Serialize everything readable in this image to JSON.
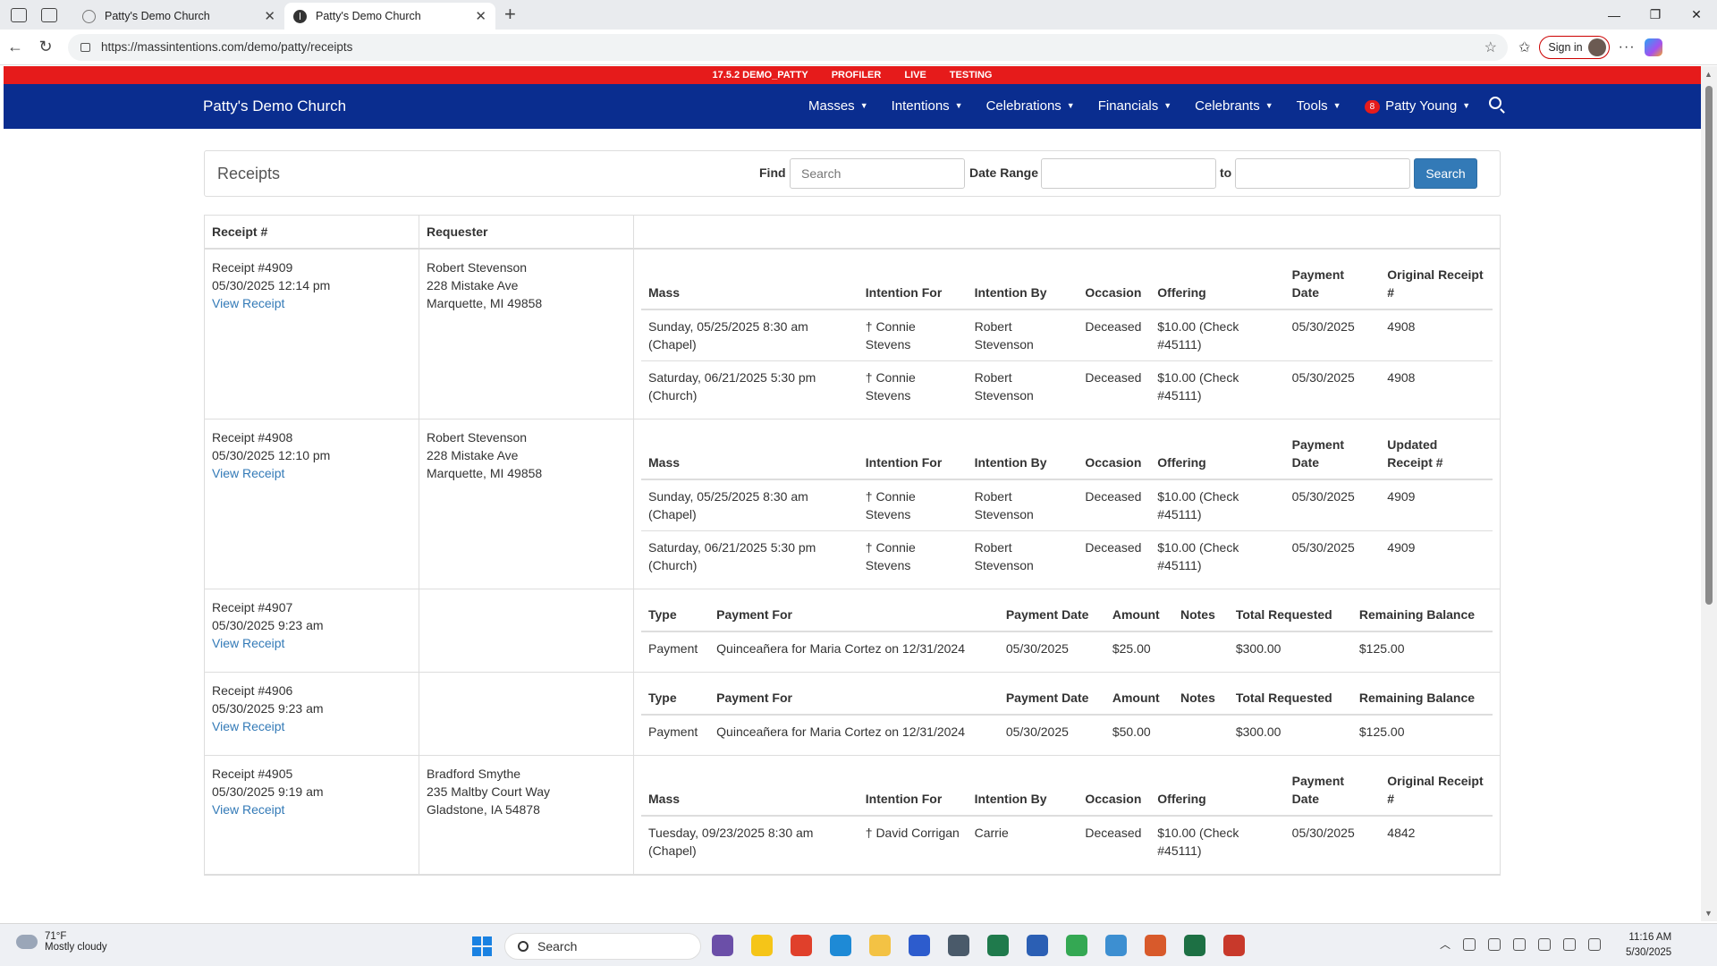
{
  "browser": {
    "tabs": [
      {
        "title": "Patty's Demo Church",
        "active": false
      },
      {
        "title": "Patty's Demo Church",
        "active": true
      }
    ],
    "url": "https://massintentions.com/demo/patty/receipts",
    "signin_label": "Sign in"
  },
  "env_bar": [
    "17.5.2 DEMO_PATTY",
    "PROFILER",
    "LIVE",
    "TESTING"
  ],
  "navbar": {
    "brand": "Patty's Demo Church",
    "menu": [
      "Masses",
      "Intentions",
      "Celebrations",
      "Financials",
      "Celebrants",
      "Tools"
    ],
    "user": {
      "badge": "8",
      "name": "Patty Young"
    }
  },
  "receipts_panel": {
    "title": "Receipts",
    "find_label": "Find",
    "find_placeholder": "Search",
    "date_range_label": "Date Range",
    "to_label": "to",
    "search_button": "Search"
  },
  "table": {
    "headers": [
      "Receipt #",
      "Requester"
    ],
    "receipts": [
      {
        "number": "Receipt #4909",
        "datetime": "05/30/2025 12:14 pm",
        "link": "View Receipt",
        "requester": [
          "Robert Stevenson",
          "228 Mistake Ave",
          "Marquette, MI 49858"
        ],
        "kind": "intentions",
        "columns": [
          "Mass",
          "Intention For",
          "Intention By",
          "Occasion",
          "Offering",
          "Payment Date",
          "Original Receipt #"
        ],
        "rows": [
          [
            "Sunday, 05/25/2025 8:30 am (Chapel)",
            "† Connie Stevens",
            "Robert Stevenson",
            "Deceased",
            "$10.00 (Check #45111)",
            "05/30/2025",
            "4908"
          ],
          [
            "Saturday, 06/21/2025 5:30 pm (Church)",
            "† Connie Stevens",
            "Robert Stevenson",
            "Deceased",
            "$10.00 (Check #45111)",
            "05/30/2025",
            "4908"
          ]
        ]
      },
      {
        "number": "Receipt #4908",
        "datetime": "05/30/2025 12:10 pm",
        "link": "View Receipt",
        "requester": [
          "Robert Stevenson",
          "228 Mistake Ave",
          "Marquette, MI 49858"
        ],
        "kind": "intentions",
        "columns": [
          "Mass",
          "Intention For",
          "Intention By",
          "Occasion",
          "Offering",
          "Payment Date",
          "Updated Receipt #"
        ],
        "rows": [
          [
            "Sunday, 05/25/2025 8:30 am (Chapel)",
            "† Connie Stevens",
            "Robert Stevenson",
            "Deceased",
            "$10.00 (Check #45111)",
            "05/30/2025",
            "4909"
          ],
          [
            "Saturday, 06/21/2025 5:30 pm (Church)",
            "† Connie Stevens",
            "Robert Stevenson",
            "Deceased",
            "$10.00 (Check #45111)",
            "05/30/2025",
            "4909"
          ]
        ]
      },
      {
        "number": "Receipt #4907",
        "datetime": "05/30/2025 9:23 am",
        "link": "View Receipt",
        "requester": [],
        "kind": "payment",
        "columns": [
          "Type",
          "Payment For",
          "Payment Date",
          "Amount",
          "Notes",
          "Total Requested",
          "Remaining Balance"
        ],
        "rows": [
          [
            "Payment",
            "Quinceañera for Maria Cortez on 12/31/2024",
            "05/30/2025",
            "$25.00",
            "",
            "$300.00",
            "$125.00"
          ]
        ]
      },
      {
        "number": "Receipt #4906",
        "datetime": "05/30/2025 9:23 am",
        "link": "View Receipt",
        "requester": [],
        "kind": "payment",
        "columns": [
          "Type",
          "Payment For",
          "Payment Date",
          "Amount",
          "Notes",
          "Total Requested",
          "Remaining Balance"
        ],
        "rows": [
          [
            "Payment",
            "Quinceañera for Maria Cortez on 12/31/2024",
            "05/30/2025",
            "$50.00",
            "",
            "$300.00",
            "$125.00"
          ]
        ]
      },
      {
        "number": "Receipt #4905",
        "datetime": "05/30/2025 9:19 am",
        "link": "View Receipt",
        "requester": [
          "Bradford Smythe",
          "235 Maltby Court Way",
          "Gladstone, IA 54878"
        ],
        "kind": "intentions",
        "columns": [
          "Mass",
          "Intention For",
          "Intention By",
          "Occasion",
          "Offering",
          "Payment Date",
          "Original Receipt #"
        ],
        "rows": [
          [
            "Tuesday, 09/23/2025 8:30 am (Chapel)",
            "† David Corrigan",
            "Carrie",
            "Deceased",
            "$10.00 (Check #45111)",
            "05/30/2025",
            "4842"
          ]
        ]
      }
    ]
  },
  "taskbar": {
    "weather_temp": "71°F",
    "weather_desc": "Mostly cloudy",
    "search_label": "Search",
    "time": "11:16 AM",
    "date": "5/30/2025"
  }
}
